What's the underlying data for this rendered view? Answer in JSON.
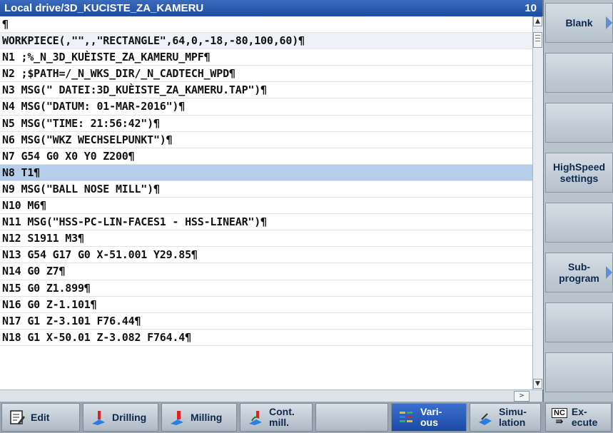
{
  "editor": {
    "path": "Local drive/3D_KUCISTE_ZA_KAMERU",
    "line_count": "10",
    "lines": [
      "¶",
      "WORKPIECE(,\"\",,\"RECTANGLE\",64,0,-18,-80,100,60)¶",
      "N1 ;%_N_3D_KUÈISTE_ZA_KAMERU_MPF¶",
      "N2 ;$PATH=/_N_WKS_DIR/_N_CADTECH_WPD¶",
      "N3 MSG(\" DATEI:3D_KUÈISTE_ZA_KAMERU.TAP\")¶",
      "N4 MSG(\"DATUM: 01-MAR-2016\")¶",
      "N5 MSG(\"TIME: 21:56:42\")¶",
      "N6 MSG(\"WKZ WECHSELPUNKT\")¶",
      "N7 G54 G0 X0 Y0 Z200¶",
      "N8 T1¶",
      "N9 MSG(\"BALL NOSE MILL\")¶",
      "N10 M6¶",
      "N11 MSG(\"HSS-PC-LIN-FACES1 - HSS-LINEAR\")¶",
      "N12 S1911 M3¶",
      "N13 G54 G17 G0 X-51.001 Y29.85¶",
      "N14 G0 Z7¶",
      "N15 G0 Z1.899¶",
      "N16 G0 Z-1.101¶",
      "N17 G1 Z-3.101 F76.44¶",
      "N18 G1 X-50.01 Z-3.082 F764.4¶"
    ],
    "highlighted_line": 9,
    "scroll_right_glyph": ">"
  },
  "right_softkeys": [
    {
      "label": "Blank",
      "arrow": true
    },
    {
      "label": "",
      "arrow": false
    },
    {
      "label": "",
      "arrow": false
    },
    {
      "label": "HighSpeed\nsettings",
      "arrow": false
    },
    {
      "label": "",
      "arrow": false
    },
    {
      "label": "Sub-\nprogram",
      "arrow": true
    },
    {
      "label": "",
      "arrow": false
    },
    {
      "label": "",
      "arrow": false
    }
  ],
  "bottom_softkeys": {
    "edit": "Edit",
    "drilling": "Drilling",
    "milling": "Milling",
    "cont_mill": "Cont.\nmill.",
    "empty": "",
    "various": "Vari-\nous",
    "simulation": "Simu-\nlation",
    "execute": "Ex-\necute",
    "execute_badge": "NC"
  },
  "colors": {
    "accent": "#1d4c9f",
    "highlight": "#b5cde8"
  }
}
